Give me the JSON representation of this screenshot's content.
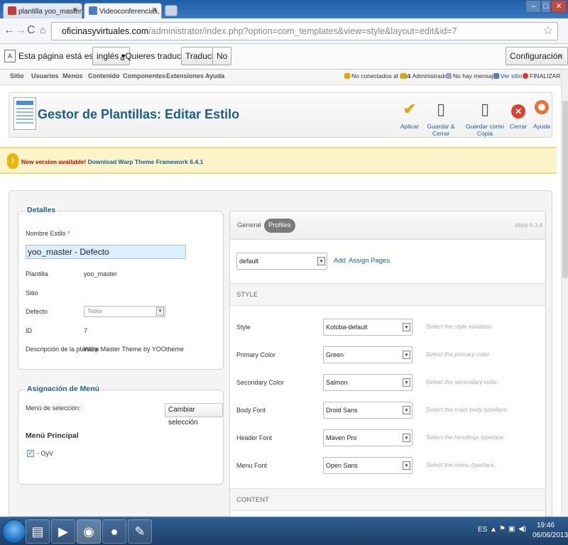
{
  "browser": {
    "tabs": [
      {
        "title": "plantilla yoo_master respo",
        "active": false
      },
      {
        "title": "Videoconferencias, Oficin",
        "active": true
      }
    ],
    "url_host": "oficinasyvirtuales.com",
    "url_path": "/administrator/index.php?option=com_templates&view=style&layout=edit&id=7"
  },
  "translate_bar": {
    "text": "Esta página está escrita en",
    "language": "inglés",
    "question": "¿Quieres traducirla?",
    "translate_label": "Traducir",
    "no_label": "No",
    "config_label": "Configuración",
    "close_symbol": "×"
  },
  "admin_menu": {
    "items": [
      "Sitio",
      "Usuarios",
      "Menús",
      "Contenido",
      "Componentes",
      "Extensiones",
      "Ayuda"
    ],
    "status": [
      "No conectados al sitio",
      "1 Administrador",
      "No hay mensajes",
      "Ver sitio",
      "FINALIZAR"
    ]
  },
  "toolbar": {
    "title": "Gestor de Plantillas: Editar Estilo",
    "buttons": [
      "Aplicar",
      "Guardar & Cerrar",
      "Guardar como Copia",
      "Cerrar",
      "Ayuda"
    ]
  },
  "notice": {
    "prefix": "New version available!",
    "link": "Download Warp Theme Framework 6.4.1"
  },
  "details": {
    "legend": "Detalles",
    "style_name_label": "Nombre Estilo",
    "required_mark": "*",
    "style_name_value": "yoo_master - Defecto",
    "template_label": "Plantilla",
    "template_value": "yoo_master",
    "site_label": "Sitio",
    "default_label": "Defecto",
    "default_value": "Todos",
    "id_label": "ID",
    "id_value": "7",
    "description_label": "Descripción de la plantilla",
    "description_value": "Warp Master Theme by YOOtheme"
  },
  "menu_assignment": {
    "legend": "Asignación de Menú",
    "selection_label": "Menú de selección:",
    "change_button": "Cambiar selección",
    "menu_title": "Menú Principal",
    "item_label": "- OyV",
    "item_checked": true
  },
  "warp": {
    "tabs": [
      "General",
      "Profiles"
    ],
    "active_tab": "Profiles",
    "version": "Warp 6.3.4",
    "profile_value": "default",
    "add_link": "Add",
    "separator": "|",
    "assign_link": "Assign Pages",
    "style_header": "STYLE",
    "content_header": "CONTENT",
    "rows": [
      {
        "label": "Style",
        "value": "Kotoba-default",
        "hint": "Select the style variation."
      },
      {
        "label": "Primary Color",
        "value": "Green",
        "hint": "Select the primary color."
      },
      {
        "label": "Secondary Color",
        "value": "Salmon",
        "hint": "Select the secondary color."
      },
      {
        "label": "Body Font",
        "value": "Droid Sans",
        "hint": "Select the main body typeface."
      },
      {
        "label": "Header Font",
        "value": "Maven Pro",
        "hint": "Select the headings typeface."
      },
      {
        "label": "Menu Font",
        "value": "Open Sans",
        "hint": "Select the menu typeface."
      }
    ]
  },
  "taskbar": {
    "language": "ES",
    "time": "19:46",
    "date": "06/06/2013"
  },
  "colors": {
    "accent_blue": "#1a5d91",
    "notice_bg": "#fbf4c8",
    "apply_orange": "#f0a000",
    "close_red": "#e04030"
  }
}
